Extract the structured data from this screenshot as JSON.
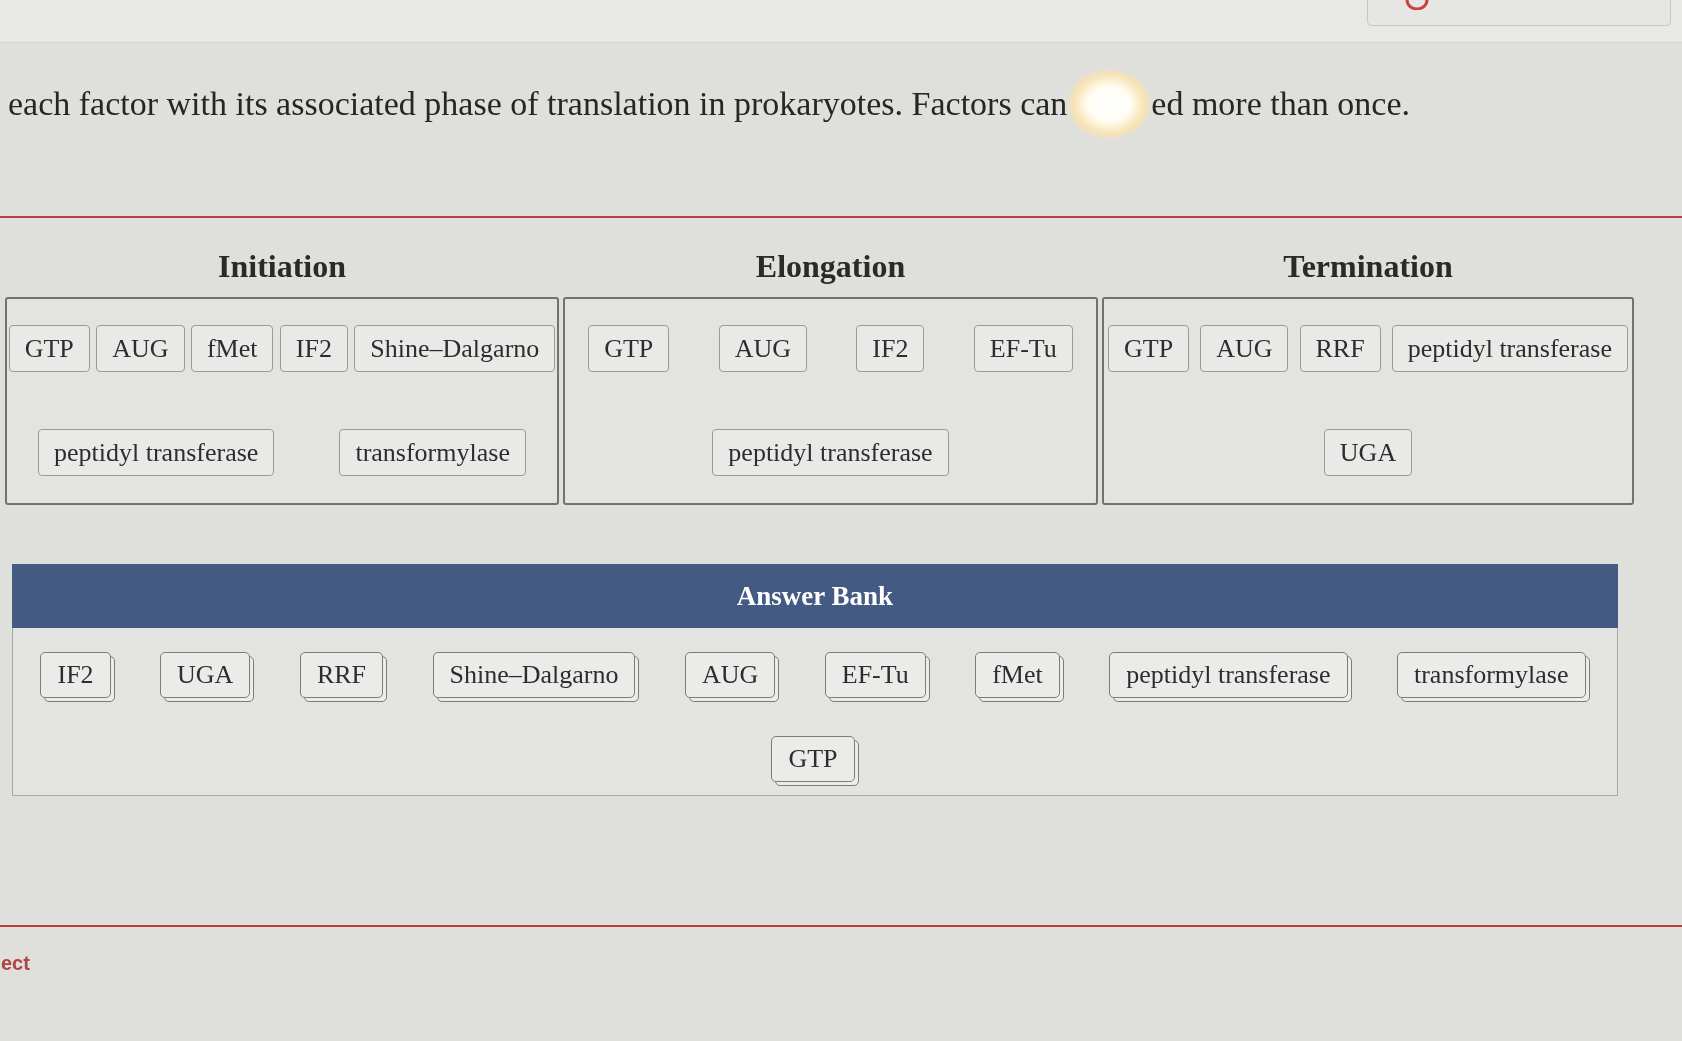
{
  "instructions": [
    "each factor with its associated phase of translation in prokaryotes. Factors can",
    "ed more than once."
  ],
  "phases": [
    {
      "title": "Initiation",
      "items": [
        "GTP",
        "AUG",
        "fMet",
        "IF2",
        "Shine–Dalgarno",
        "peptidyl transferase",
        "transformylase"
      ]
    },
    {
      "title": "Elongation",
      "items": [
        "GTP",
        "AUG",
        "IF2",
        "EF-Tu",
        "peptidyl transferase"
      ]
    },
    {
      "title": "Termination",
      "items": [
        "GTP",
        "AUG",
        "RRF",
        "peptidyl transferase",
        "UGA"
      ]
    }
  ],
  "answer_bank": {
    "title": "Answer Bank",
    "items": [
      "IF2",
      "UGA",
      "RRF",
      "Shine–Dalgarno",
      "AUG",
      "EF-Tu",
      "fMet",
      "peptidyl transferase",
      "transformylase",
      "GTP"
    ]
  },
  "feedback": "ect"
}
